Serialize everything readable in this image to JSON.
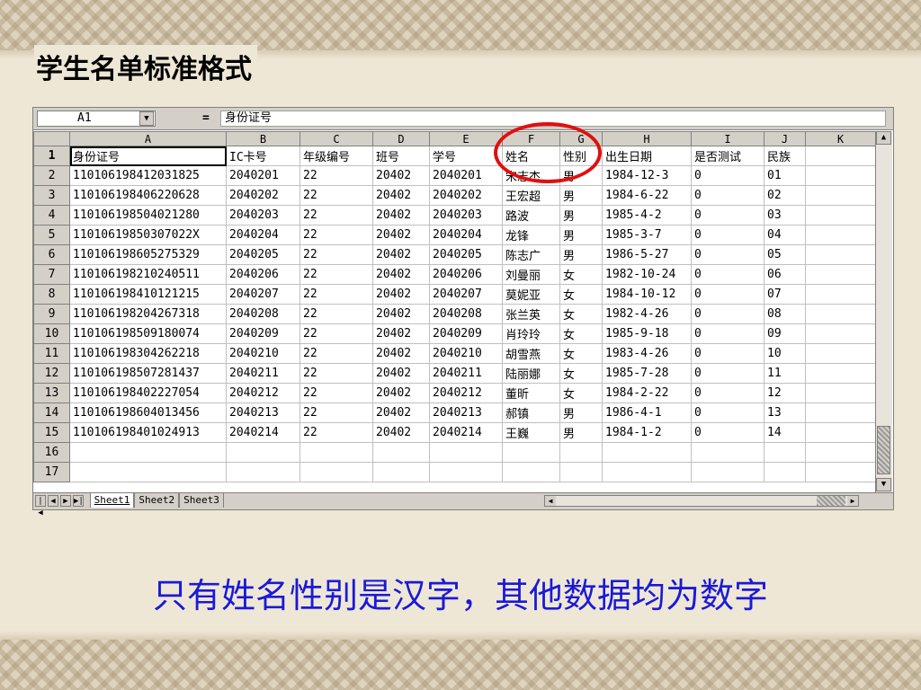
{
  "slide": {
    "title": "学生名单标准格式",
    "caption": "只有姓名性别是汉字，其他数据均为数字"
  },
  "formula_bar": {
    "name_box": "A1",
    "equals": "=",
    "content": "身份证号"
  },
  "grid": {
    "columns": [
      "A",
      "B",
      "C",
      "D",
      "E",
      "F",
      "G",
      "H",
      "I",
      "J",
      "K"
    ],
    "rows": [
      {
        "num": "1",
        "cells": [
          "身份证号",
          "IC卡号",
          "年级编号",
          "班号",
          "学号",
          "姓名",
          "性别",
          "出生日期",
          "是否测试",
          "民族",
          ""
        ]
      },
      {
        "num": "2",
        "cells": [
          "110106198412031825",
          "2040201",
          "22",
          "20402",
          "2040201",
          "宋志杰",
          "男",
          "1984-12-3",
          "0",
          "01",
          ""
        ]
      },
      {
        "num": "3",
        "cells": [
          "110106198406220628",
          "2040202",
          "22",
          "20402",
          "2040202",
          "王宏超",
          "男",
          "1984-6-22",
          "0",
          "02",
          ""
        ]
      },
      {
        "num": "4",
        "cells": [
          "110106198504021280",
          "2040203",
          "22",
          "20402",
          "2040203",
          "路波",
          "男",
          "1985-4-2",
          "0",
          "03",
          ""
        ]
      },
      {
        "num": "5",
        "cells": [
          "11010619850307022X",
          "2040204",
          "22",
          "20402",
          "2040204",
          "龙锋",
          "男",
          "1985-3-7",
          "0",
          "04",
          ""
        ]
      },
      {
        "num": "6",
        "cells": [
          "110106198605275329",
          "2040205",
          "22",
          "20402",
          "2040205",
          "陈志广",
          "男",
          "1986-5-27",
          "0",
          "05",
          ""
        ]
      },
      {
        "num": "7",
        "cells": [
          "110106198210240511",
          "2040206",
          "22",
          "20402",
          "2040206",
          "刘曼丽",
          "女",
          "1982-10-24",
          "0",
          "06",
          ""
        ]
      },
      {
        "num": "8",
        "cells": [
          "110106198410121215",
          "2040207",
          "22",
          "20402",
          "2040207",
          "莫妮亚",
          "女",
          "1984-10-12",
          "0",
          "07",
          ""
        ]
      },
      {
        "num": "9",
        "cells": [
          "110106198204267318",
          "2040208",
          "22",
          "20402",
          "2040208",
          "张兰英",
          "女",
          "1982-4-26",
          "0",
          "08",
          ""
        ]
      },
      {
        "num": "10",
        "cells": [
          "110106198509180074",
          "2040209",
          "22",
          "20402",
          "2040209",
          "肖玲玲",
          "女",
          "1985-9-18",
          "0",
          "09",
          ""
        ]
      },
      {
        "num": "11",
        "cells": [
          "110106198304262218",
          "2040210",
          "22",
          "20402",
          "2040210",
          "胡雪燕",
          "女",
          "1983-4-26",
          "0",
          "10",
          ""
        ]
      },
      {
        "num": "12",
        "cells": [
          "110106198507281437",
          "2040211",
          "22",
          "20402",
          "2040211",
          "陆丽娜",
          "女",
          "1985-7-28",
          "0",
          "11",
          ""
        ]
      },
      {
        "num": "13",
        "cells": [
          "110106198402227054",
          "2040212",
          "22",
          "20402",
          "2040212",
          "董昕",
          "女",
          "1984-2-22",
          "0",
          "12",
          ""
        ]
      },
      {
        "num": "14",
        "cells": [
          "110106198604013456",
          "2040213",
          "22",
          "20402",
          "2040213",
          "郝镇",
          "男",
          "1986-4-1",
          "0",
          "13",
          ""
        ]
      },
      {
        "num": "15",
        "cells": [
          "110106198401024913",
          "2040214",
          "22",
          "20402",
          "2040214",
          "王巍",
          "男",
          "1984-1-2",
          "0",
          "14",
          ""
        ]
      },
      {
        "num": "16",
        "cells": [
          "",
          "",
          "",
          "",
          "",
          "",
          "",
          "",
          "",
          "",
          ""
        ]
      },
      {
        "num": "17",
        "cells": [
          "",
          "",
          "",
          "",
          "",
          "",
          "",
          "",
          "",
          "",
          ""
        ]
      }
    ]
  },
  "sheet_tabs": [
    "Sheet1",
    "Sheet2",
    "Sheet3"
  ],
  "colors": {
    "caption": "#1a1ad6",
    "highlight": "#e01010",
    "chrome": "#d4d0c8"
  }
}
